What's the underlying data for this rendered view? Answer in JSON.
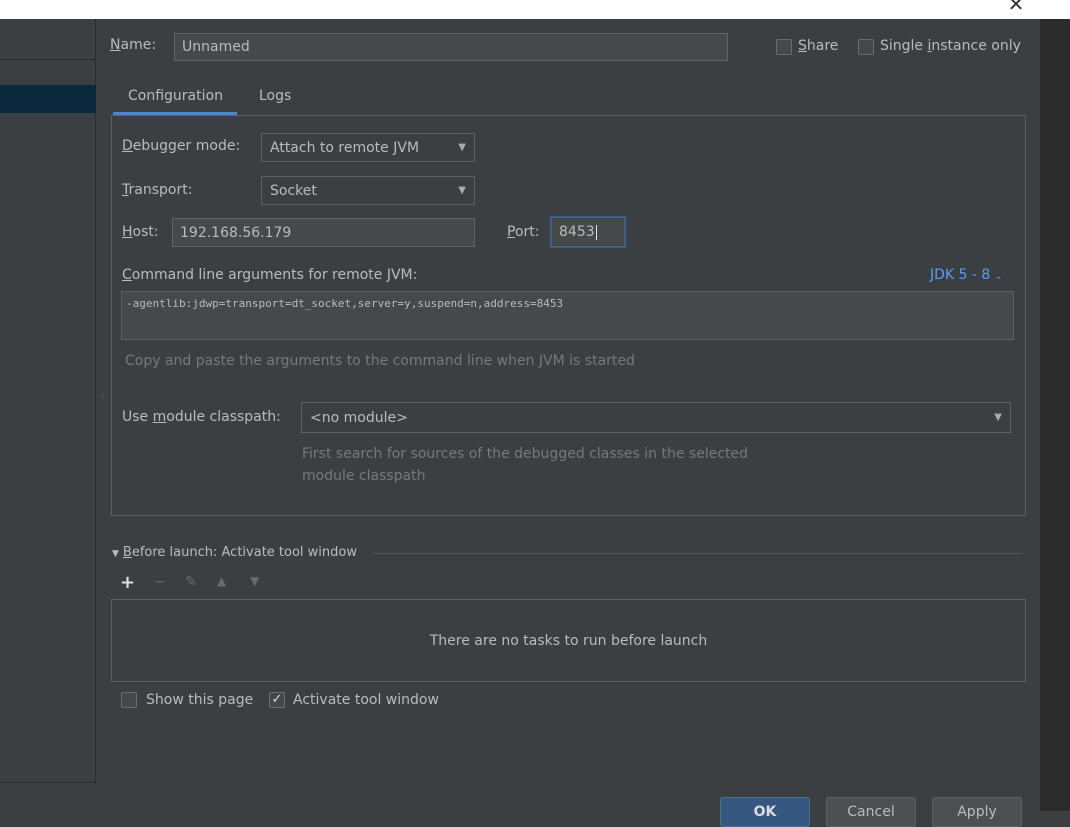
{
  "window": {
    "close_glyph": "✕"
  },
  "name": {
    "label_mn": "N",
    "label_rest": "ame:",
    "value": "Unnamed"
  },
  "share": {
    "label_mn": "S",
    "label_rest": "hare",
    "checked": false
  },
  "single_instance": {
    "label_pre": "Single ",
    "label_mn": "i",
    "label_rest": "nstance only",
    "checked": false
  },
  "tabs": [
    {
      "label": "Configuration",
      "active": true
    },
    {
      "label": "Logs",
      "active": false
    }
  ],
  "debugger_mode": {
    "label_mn": "D",
    "label_rest": "ebugger mode:",
    "value": "Attach to remote JVM"
  },
  "transport": {
    "label_mn": "T",
    "label_rest": "ransport:",
    "value": "Socket"
  },
  "host": {
    "label_mn": "H",
    "label_rest": "ost:",
    "value": "192.168.56.179"
  },
  "port": {
    "label_mn": "P",
    "label_rest": "ort:",
    "value": "8453"
  },
  "cmdline": {
    "label_mn": "C",
    "label_rest": "ommand line arguments for remote JVM:",
    "jdk_link": "JDK 5 - 8",
    "value": "-agentlib:jdwp=transport=dt_socket,server=y,suspend=n,address=8453",
    "hint": "Copy and paste the arguments to the command line when JVM is started"
  },
  "module_classpath": {
    "label_pre": "Use ",
    "label_mn": "m",
    "label_rest": "odule classpath:",
    "value": "<no module>",
    "hint_line1": "First search for sources of the debugged classes in the selected",
    "hint_line2": "module classpath"
  },
  "before_launch": {
    "label_mn": "B",
    "label_rest": "efore launch: Activate tool window",
    "empty_text": "There are no tasks to run before launch"
  },
  "show_this_page": {
    "label": "Show this page",
    "checked": false
  },
  "activate_tool_window": {
    "label": "Activate tool window",
    "checked": true
  },
  "buttons": {
    "ok": "OK",
    "cancel": "Cancel",
    "apply": "Apply"
  },
  "colors": {
    "background": "#3c3f41",
    "accent": "#4a88c7",
    "link": "#589df6",
    "default_button": "#365880"
  }
}
